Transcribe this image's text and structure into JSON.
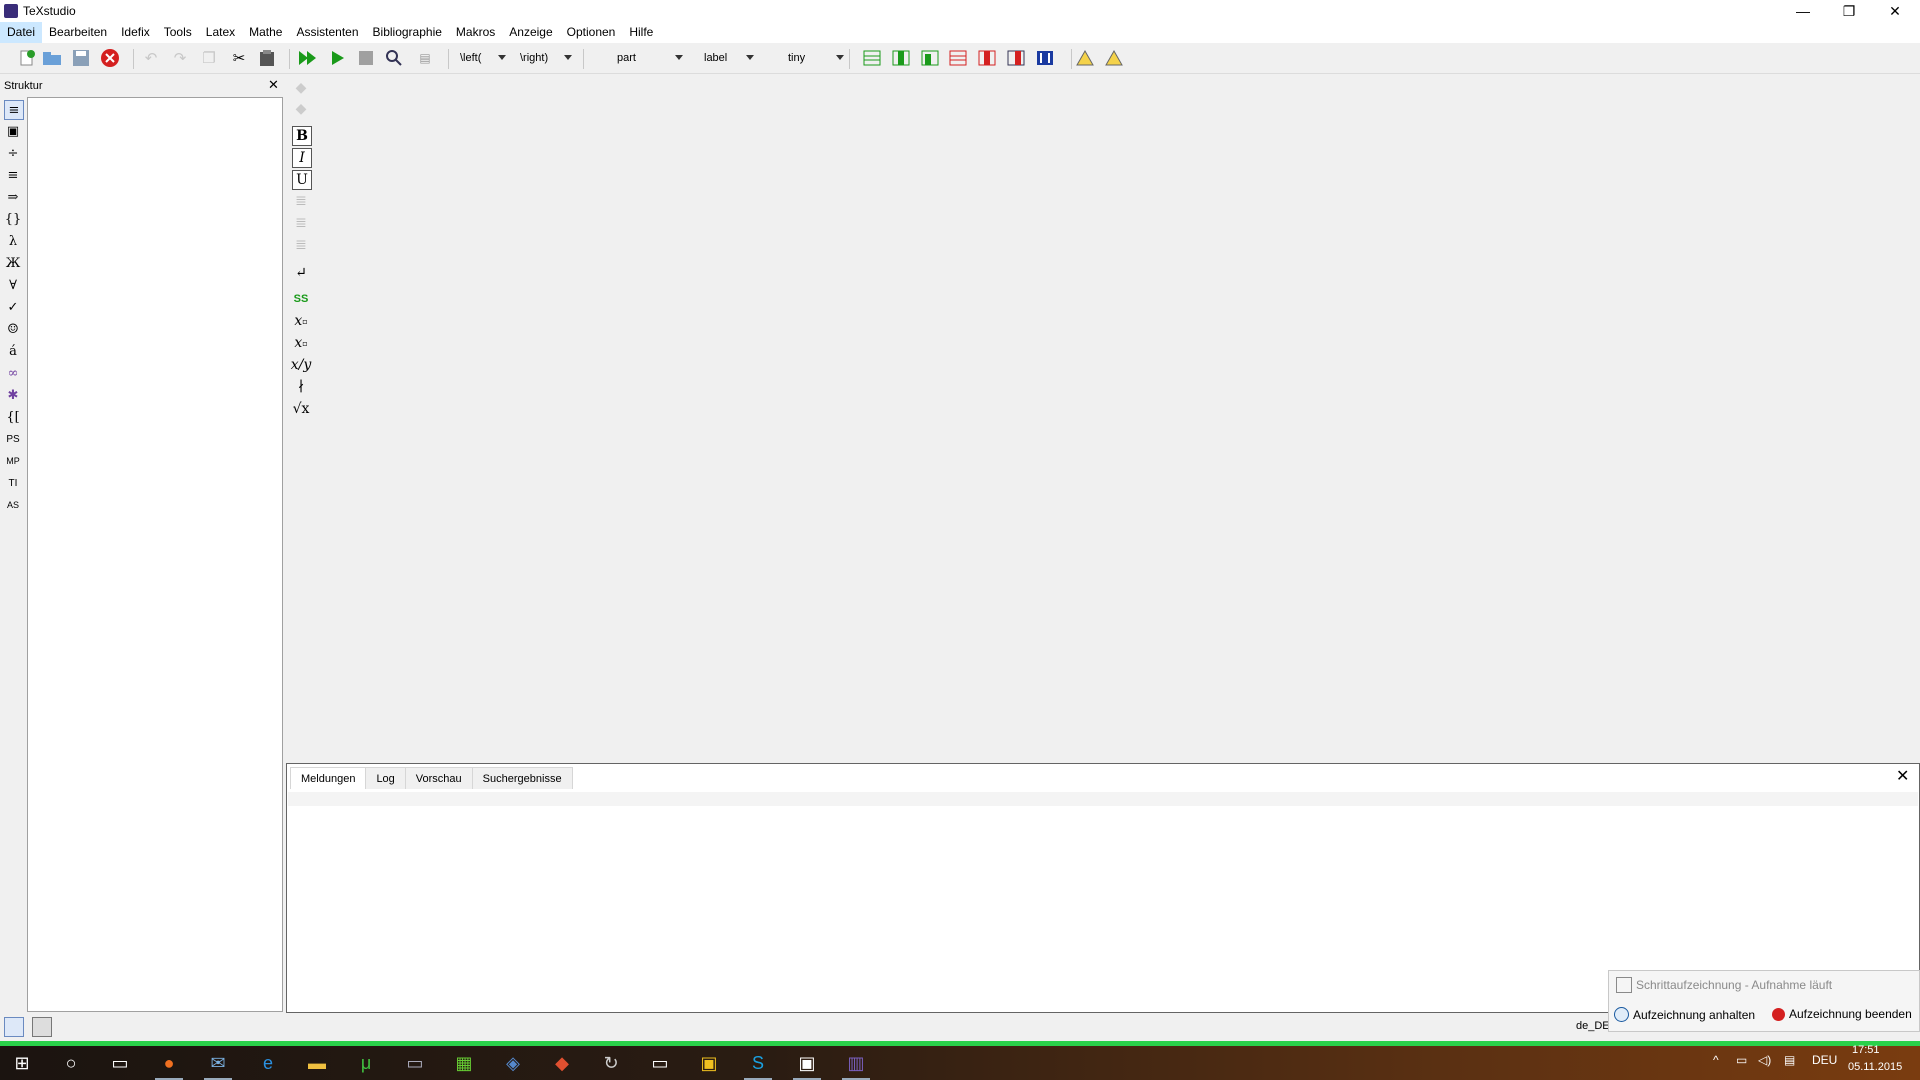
{
  "window": {
    "title": "TeXstudio",
    "minimize_icon": "—",
    "restore_icon": "❐",
    "close_icon": "✕"
  },
  "menu": [
    "Datei",
    "Bearbeiten",
    "Idefix",
    "Tools",
    "Latex",
    "Mathe",
    "Assistenten",
    "Bibliographie",
    "Makros",
    "Anzeige",
    "Optionen",
    "Hilfe"
  ],
  "toolbar": {
    "combos": [
      "\\left(",
      "\\right)",
      "part",
      "label",
      "tiny"
    ]
  },
  "structure": {
    "title": "Struktur",
    "close": "✕"
  },
  "latex_bar": {
    "bold": "B",
    "italic": "I",
    "underline": "U",
    "ss": "SS"
  },
  "side_icons": {
    "ps": "PS",
    "mp": "MP",
    "ti": "TI",
    "as": "AS"
  },
  "messages": {
    "tabs": [
      "Meldungen",
      "Log",
      "Vorschau",
      "Suchergebnisse"
    ],
    "close": "✕"
  },
  "status": {
    "language": "de_DE"
  },
  "notification": {
    "title": "Schrittaufzeichnung - Aufnahme läuft",
    "pause": "Aufzeichnung anhalten",
    "stop": "Aufzeichnung beenden"
  },
  "taskbar": {
    "time": "17:51",
    "date": "05.11.2015",
    "lang": "DEU",
    "accent": "#2ad14a"
  }
}
